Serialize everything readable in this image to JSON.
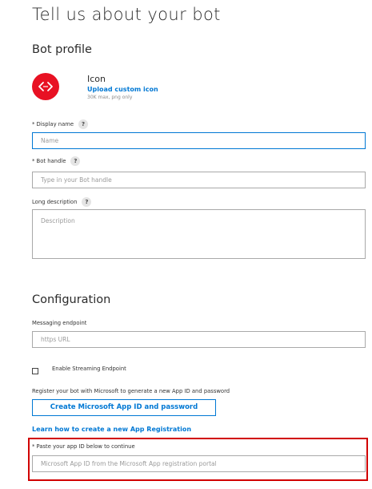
{
  "page": {
    "title": "Tell us about your bot"
  },
  "bot_profile": {
    "section_title": "Bot profile",
    "icon_label": "Icon",
    "upload_link": "Upload custom icon",
    "upload_hint": "30K max, png only",
    "icon_color": "#e81123",
    "display_name": {
      "label": "* Display name",
      "placeholder": "Name",
      "value": ""
    },
    "bot_handle": {
      "label": "* Bot handle",
      "placeholder": "Type in your Bot handle",
      "value": ""
    },
    "long_description": {
      "label": "Long description",
      "placeholder": "Description",
      "value": ""
    },
    "help_glyph": "?"
  },
  "configuration": {
    "section_title": "Configuration",
    "messaging_endpoint": {
      "label": "Messaging endpoint",
      "placeholder": "https URL",
      "value": ""
    },
    "streaming_checkbox": {
      "label": "Enable Streaming Endpoint",
      "checked": false
    },
    "register_text": "Register your bot with Microsoft to generate a new App ID and password",
    "create_button": "Create Microsoft App ID and password",
    "learn_link": "Learn how to create a new App Registration",
    "app_id": {
      "label": "* Paste your app ID below to continue",
      "placeholder": "Microsoft App ID from the Microsoft App registration portal",
      "value": ""
    }
  },
  "colors": {
    "accent": "#0078d4",
    "highlight": "#d10000"
  }
}
